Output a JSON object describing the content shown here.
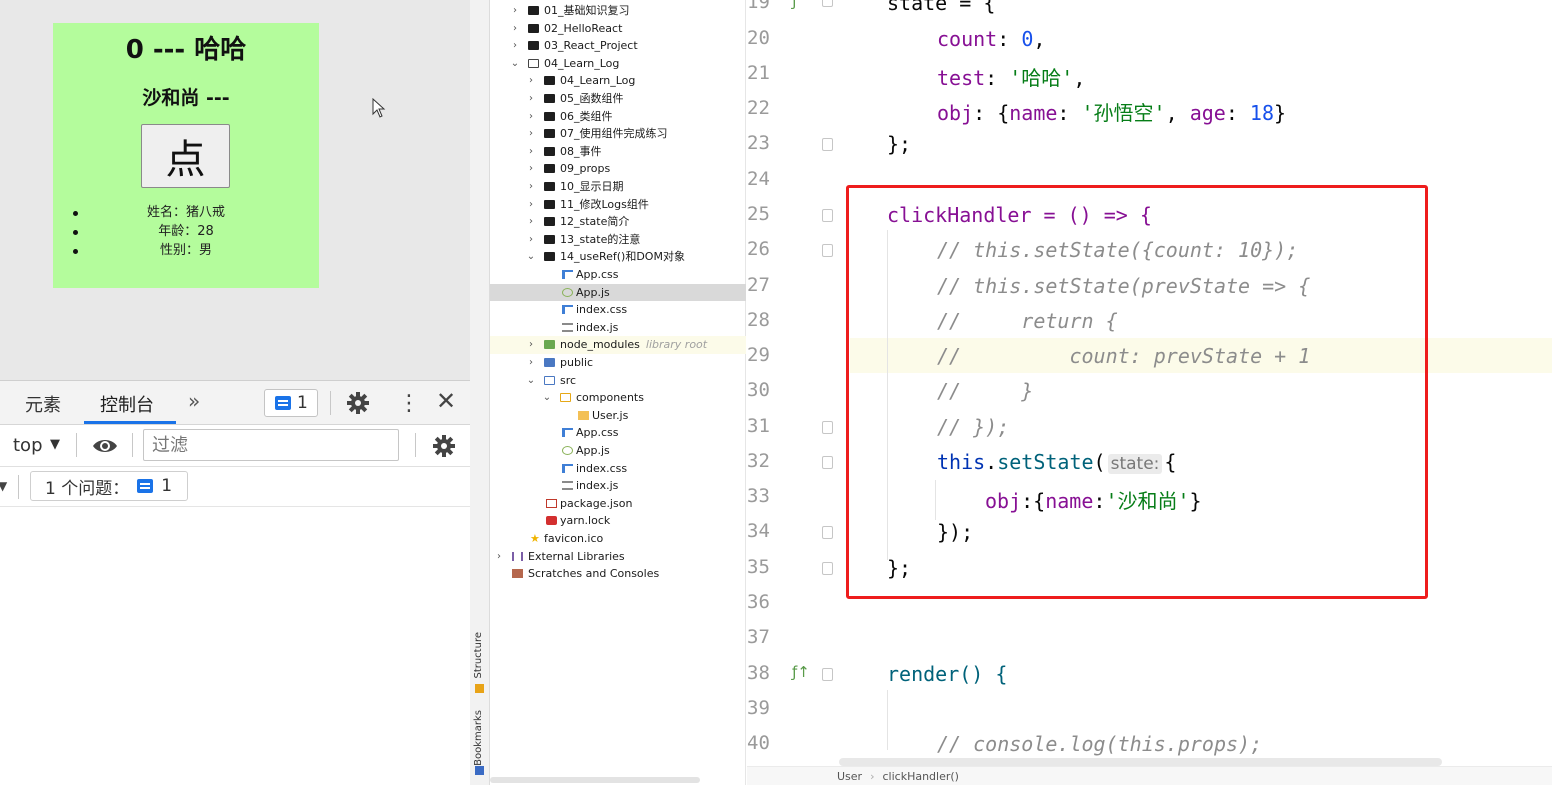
{
  "preview": {
    "title": "0 --- 哈哈",
    "subtitle": "沙和尚 ---",
    "button_label": "点",
    "info": [
      "姓名：猪八戒",
      "年龄：28",
      "性别：男"
    ]
  },
  "devtools": {
    "tab_elements": "元素",
    "tab_console": "控制台",
    "more": "»",
    "message_count": "1",
    "context": "top",
    "filter_placeholder": "过滤",
    "issues_label": "1 个问题：",
    "issues_count": "1"
  },
  "tree": {
    "rows": [
      {
        "label": "01_基础知识复习"
      },
      {
        "label": "02_HelloReact"
      },
      {
        "label": "03_React_Project"
      },
      {
        "label": "04_Learn_Log"
      },
      {
        "label": "04_Learn_Log"
      },
      {
        "label": "05_函数组件"
      },
      {
        "label": "06_类组件"
      },
      {
        "label": "07_使用组件完成练习"
      },
      {
        "label": "08_事件"
      },
      {
        "label": "09_props"
      },
      {
        "label": "10_显示日期"
      },
      {
        "label": "11_修改Logs组件"
      },
      {
        "label": "12_state简介"
      },
      {
        "label": "13_state的注意"
      },
      {
        "label": "14_useRef()和DOM对象"
      },
      {
        "label": "App.css"
      },
      {
        "label": "App.js"
      },
      {
        "label": "index.css"
      },
      {
        "label": "index.js"
      },
      {
        "label": "node_modules",
        "extra": "library root"
      },
      {
        "label": "public"
      },
      {
        "label": "src"
      },
      {
        "label": "components"
      },
      {
        "label": "User.js"
      },
      {
        "label": "App.css"
      },
      {
        "label": "App.js"
      },
      {
        "label": "index.css"
      },
      {
        "label": "index.js"
      },
      {
        "label": "package.json"
      },
      {
        "label": "yarn.lock"
      },
      {
        "label": "favicon.ico"
      },
      {
        "label": "External Libraries"
      },
      {
        "label": "Scratches and Consoles"
      }
    ],
    "side_labels": {
      "structure": "Structure",
      "bookmarks": "Bookmarks"
    }
  },
  "editor": {
    "line_numbers": [
      "19",
      "20",
      "21",
      "22",
      "23",
      "24",
      "25",
      "26",
      "27",
      "28",
      "29",
      "30",
      "31",
      "32",
      "33",
      "34",
      "35",
      "36",
      "37",
      "38",
      "39",
      "40"
    ],
    "code": {
      "l19": "state = {",
      "l20_key": "count",
      "l20_val": "0",
      "l21_key": "test",
      "l21_val": "'哈哈'",
      "l22_key": "obj",
      "l22_k1": "name",
      "l22_v1": "'孙悟空'",
      "l22_k2": "age",
      "l22_v2": "18",
      "l23": "};",
      "l25": "clickHandler = () => {",
      "l26": "// this.setState({count: 10});",
      "l27": "// this.setState(prevState => {",
      "l28": "//     return {",
      "l29": "//         count: prevState + 1",
      "l30": "//     }",
      "l31": "// });",
      "l32_this": "this",
      "l32_fn": "setState",
      "l32_hint": "state:",
      "l33_key": "obj",
      "l33_key2": "name",
      "l33_val": "'沙和尚'",
      "l34": "});",
      "l35": "};",
      "l38": "render() {",
      "l40": "// console.log(this.props);"
    },
    "breadcrumb": [
      "User",
      "clickHandler()"
    ]
  },
  "colors": {
    "preview_bg": "#b4fc9c",
    "highlight_box": "#ee1c1c",
    "accent": "#1a73e8"
  }
}
